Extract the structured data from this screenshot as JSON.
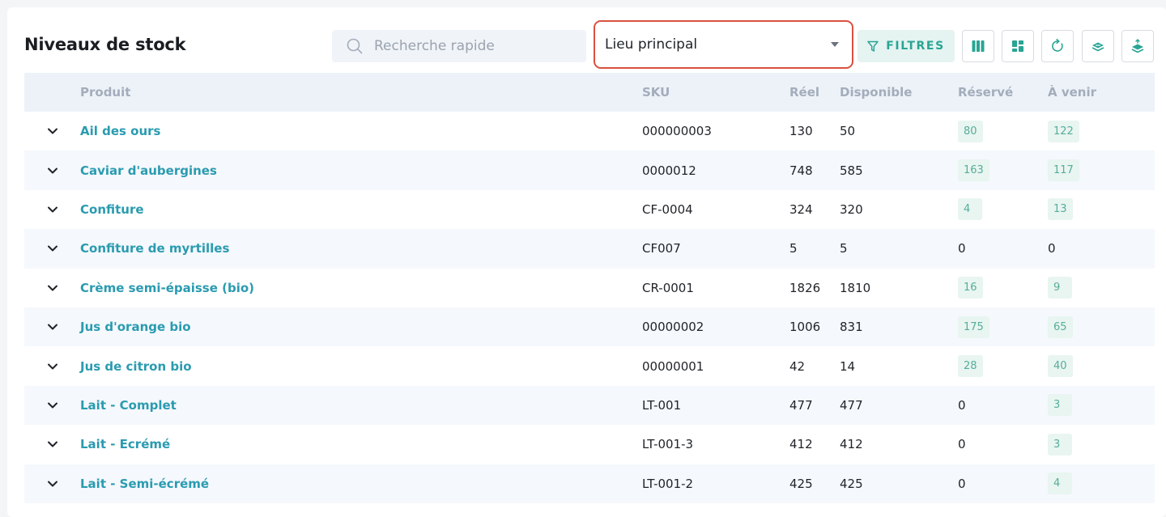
{
  "header": {
    "title": "Niveaux de stock",
    "search_placeholder": "Recherche rapide",
    "location": "Lieu principal",
    "filters_label": "FILTRES"
  },
  "table": {
    "columns": {
      "product": "Produit",
      "sku": "SKU",
      "real": "Réel",
      "available": "Disponible",
      "reserved": "Réservé",
      "upcoming": "À venir"
    },
    "rows": [
      {
        "product": "Ail des ours",
        "sku": "000000003",
        "real": "130",
        "available": "50",
        "reserved": "80",
        "upcoming": "122"
      },
      {
        "product": "Caviar d'aubergines",
        "sku": "0000012",
        "real": "748",
        "available": "585",
        "reserved": "163",
        "upcoming": "117"
      },
      {
        "product": "Confiture",
        "sku": "CF-0004",
        "real": "324",
        "available": "320",
        "reserved": "4",
        "upcoming": "13"
      },
      {
        "product": "Confiture de myrtilles",
        "sku": "CF007",
        "real": "5",
        "available": "5",
        "reserved": "0",
        "upcoming": "0"
      },
      {
        "product": "Crème semi-épaisse (bio)",
        "sku": "CR-0001",
        "real": "1826",
        "available": "1810",
        "reserved": "16",
        "upcoming": "9"
      },
      {
        "product": "Jus d'orange bio",
        "sku": "00000002",
        "real": "1006",
        "available": "831",
        "reserved": "175",
        "upcoming": "65"
      },
      {
        "product": "Jus de citron bio",
        "sku": "00000001",
        "real": "42",
        "available": "14",
        "reserved": "28",
        "upcoming": "40"
      },
      {
        "product": "Lait - Complet",
        "sku": "LT-001",
        "real": "477",
        "available": "477",
        "reserved": "0",
        "upcoming": "3"
      },
      {
        "product": "Lait - Ecrémé",
        "sku": "LT-001-3",
        "real": "412",
        "available": "412",
        "reserved": "0",
        "upcoming": "3"
      },
      {
        "product": "Lait - Semi-écrémé",
        "sku": "LT-001-2",
        "real": "425",
        "available": "425",
        "reserved": "0",
        "upcoming": "4"
      }
    ]
  },
  "colors": {
    "accent": "#29a594",
    "link": "#2a9bb0",
    "highlight_border": "#d9513f",
    "header_row_bg": "#edf2f9",
    "badge_bg": "#e8f5f0"
  },
  "icons": {
    "search": "search-icon",
    "filter": "filter-icon",
    "columns": "columns-icon",
    "layout": "layout-icon",
    "refresh": "refresh-icon",
    "stack_in": "stack-in-icon",
    "stack_out": "stack-out-icon",
    "expand": "chevron-down-icon"
  }
}
